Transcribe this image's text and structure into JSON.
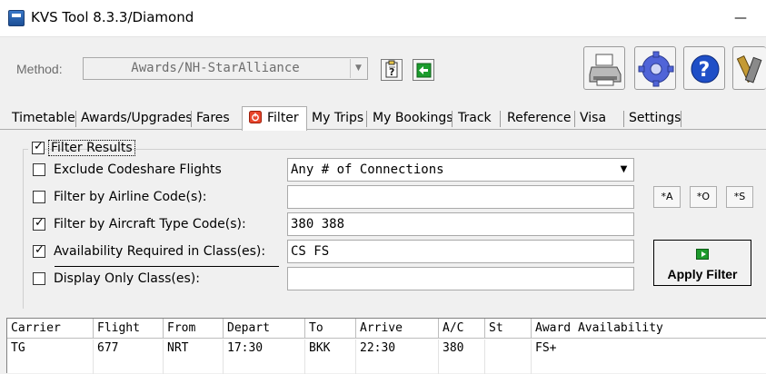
{
  "window": {
    "title": "KVS Tool 8.3.3/Diamond",
    "minimize_glyph": "—"
  },
  "toolbar": {
    "method_label": "Method:",
    "method_value": "Awards/NH-StarAlliance",
    "dropdown_arrow": "▼",
    "buttons": [
      "notes-icon",
      "go-back-icon",
      "printer-icon",
      "settings-gear-icon",
      "help-icon",
      "tools-icon"
    ]
  },
  "tabs": [
    {
      "label": "Timetable",
      "active": false
    },
    {
      "label": "Awards/Upgrades",
      "active": false
    },
    {
      "label": "Fares",
      "active": false
    },
    {
      "label": "Filter",
      "active": true
    },
    {
      "label": "My Trips",
      "active": false
    },
    {
      "label": "My Bookings",
      "active": false
    },
    {
      "label": "Track",
      "active": false
    },
    {
      "label": "Reference",
      "active": false
    },
    {
      "label": "Visa",
      "active": false
    },
    {
      "label": "Settings",
      "active": false
    }
  ],
  "filter": {
    "filter_results": {
      "label": "Filter Results",
      "checked": true
    },
    "exclude_codeshare": {
      "label": "Exclude Codeshare Flights",
      "checked": false
    },
    "connections_value": "Any # of Connections",
    "airline_code": {
      "label": "Filter by Airline Code(s):",
      "checked": false,
      "value": ""
    },
    "aircraft_type": {
      "label": "Filter by Aircraft Type Code(s):",
      "checked": true,
      "value": "380 388"
    },
    "availability": {
      "label": "Availability Required in Class(es):",
      "checked": true,
      "value": "CS FS"
    },
    "display_only": {
      "label": "Display Only Class(es):",
      "checked": false,
      "value": ""
    },
    "mini_buttons": [
      "*A",
      "*O",
      "*S"
    ],
    "apply_label": "Apply Filter",
    "check_glyph": "✓"
  },
  "results": {
    "columns": [
      "Carrier",
      "Flight",
      "From",
      "Depart",
      "To",
      "Arrive",
      "A/C",
      "St",
      "Award Availability"
    ],
    "rows": [
      [
        "TG",
        "677",
        "NRT",
        "17:30",
        "BKK",
        "22:30",
        "380",
        "",
        "FS+"
      ]
    ]
  }
}
